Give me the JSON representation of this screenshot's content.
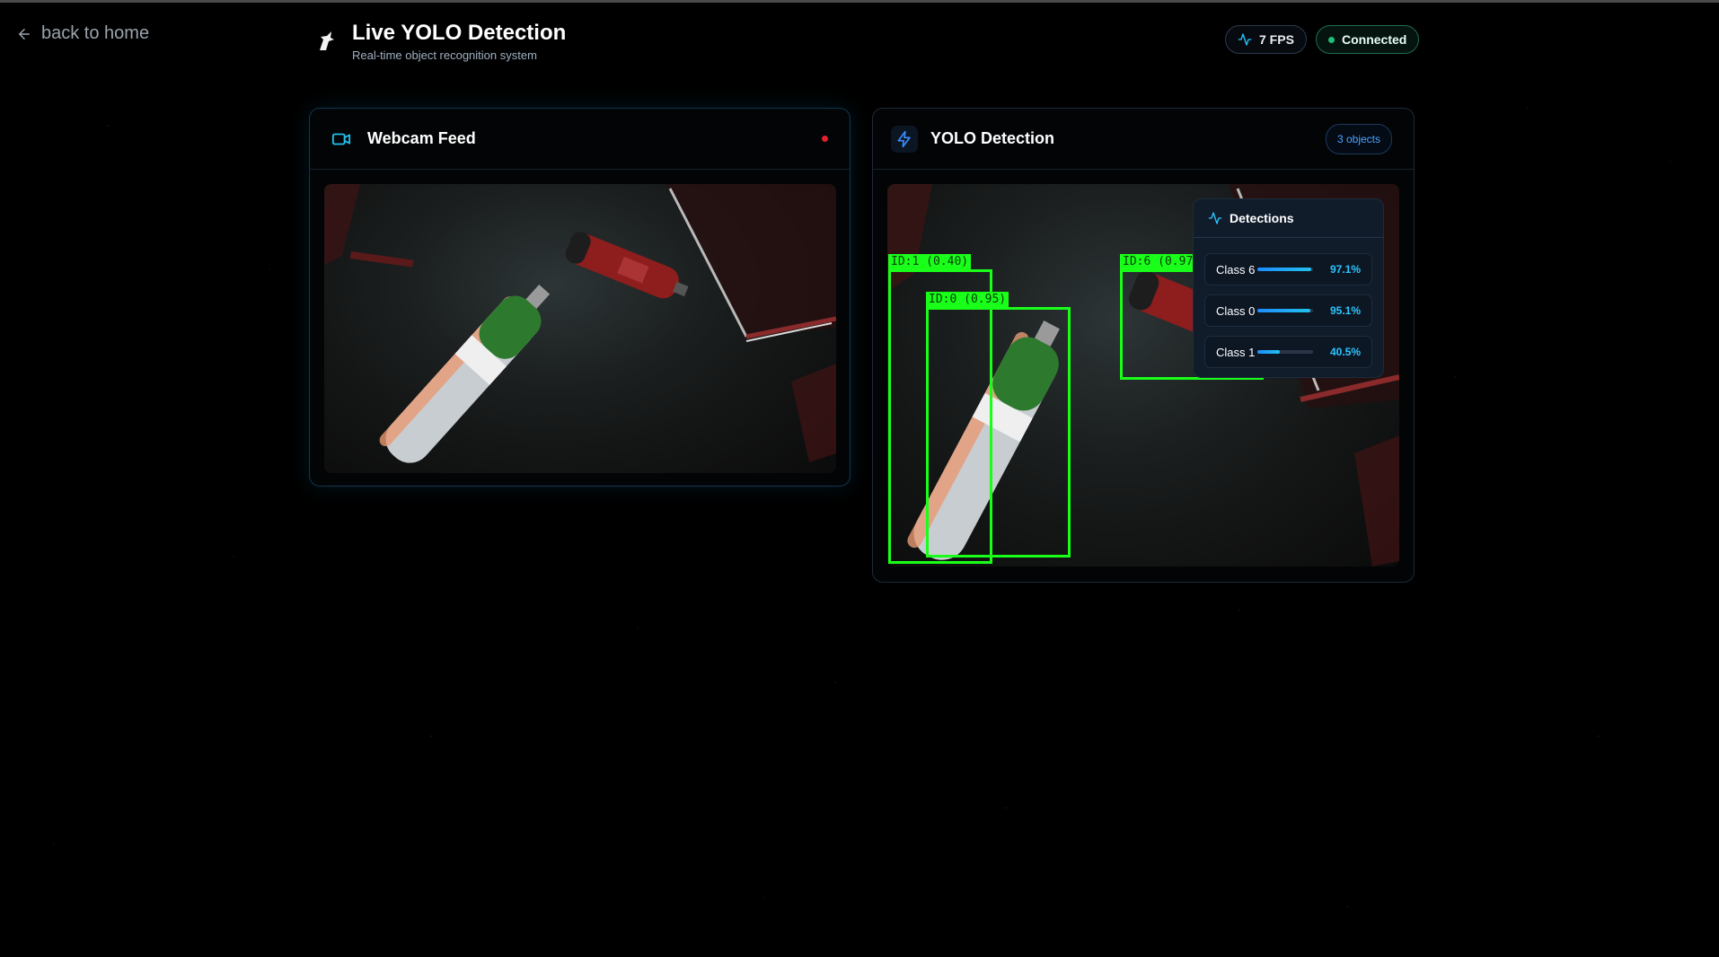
{
  "nav": {
    "back_label": "back to home"
  },
  "header": {
    "title": "Live YOLO Detection",
    "subtitle": "Real-time object recognition system"
  },
  "status": {
    "fps_label": "7 FPS",
    "connection_label": "Connected"
  },
  "webcam_panel": {
    "title": "Webcam Feed"
  },
  "detection_panel": {
    "title": "YOLO Detection",
    "objects_badge": "3 objects"
  },
  "detections_list": {
    "title": "Detections",
    "items": [
      {
        "label": "Class 6",
        "confidence": 0.971,
        "confidence_text": "97.1%"
      },
      {
        "label": "Class 0",
        "confidence": 0.951,
        "confidence_text": "95.1%"
      },
      {
        "label": "Class 1",
        "confidence": 0.405,
        "confidence_text": "40.5%"
      }
    ]
  },
  "bounding_boxes": [
    {
      "label": "ID:1 (0.40)"
    },
    {
      "label": "ID:0 (0.95)"
    },
    {
      "label": "ID:6 (0.97)"
    }
  ],
  "colors": {
    "accent": "#22c1ee",
    "box": "#19ff19",
    "recording": "#e0222c",
    "connected": "#1fbf79"
  }
}
